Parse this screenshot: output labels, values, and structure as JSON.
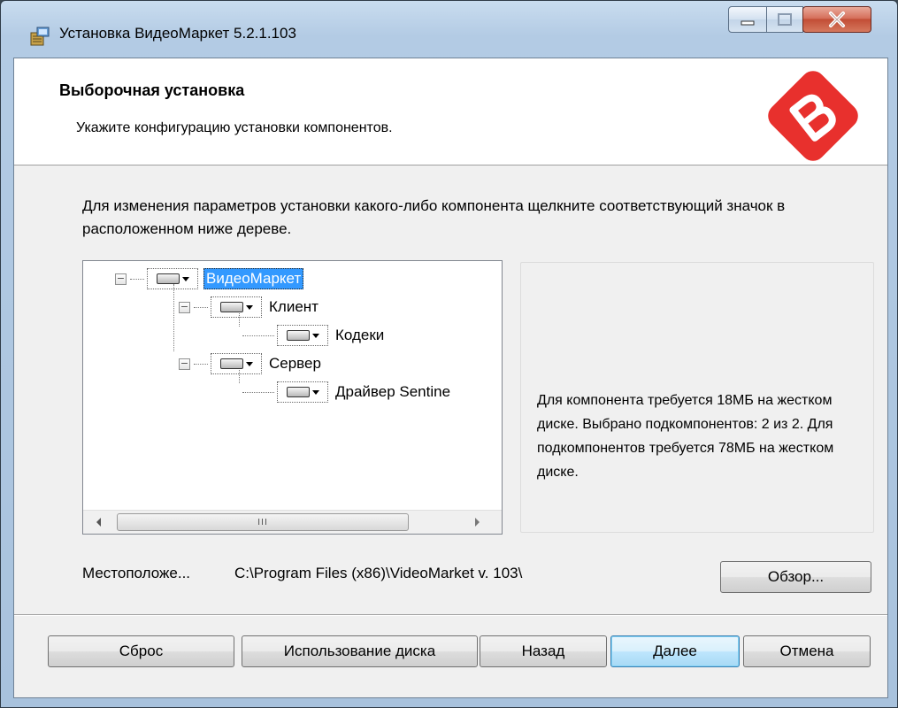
{
  "window": {
    "title": "Установка ВидеоМаркет 5.2.1.103"
  },
  "header": {
    "heading": "Выборочная установка",
    "subheading": "Укажите конфигурацию установки компонентов.",
    "logo_color": "#e8302d"
  },
  "instruction": "Для изменения параметров установки какого-либо компонента щелкните соответствующий значок в расположенном ниже дереве.",
  "tree": {
    "nodes": [
      {
        "label": "ВидеоМаркет",
        "level": 0,
        "expanded": true,
        "selected": true
      },
      {
        "label": "Клиент",
        "level": 1,
        "expanded": true
      },
      {
        "label": "Кодеки",
        "level": 2
      },
      {
        "label": "Сервер",
        "level": 1,
        "expanded": true
      },
      {
        "label": "Драйвер Sentine",
        "level": 2
      }
    ],
    "scrollbar_thumb": "III"
  },
  "info": {
    "text": "Для компонента требуется 18МБ на жестком диске. Выбрано подкомпонентов: 2 из 2. Для подкомпонентов требуется 78МБ на жестком диске."
  },
  "location": {
    "label": "Местоположе...",
    "path": "C:\\Program Files (x86)\\VideoMarket v. 103\\"
  },
  "buttons": {
    "browse": "Обзор...",
    "reset": "Сброс",
    "disk_usage": "Использование диска",
    "back": "Назад",
    "next": "Далее",
    "cancel": "Отмена"
  }
}
